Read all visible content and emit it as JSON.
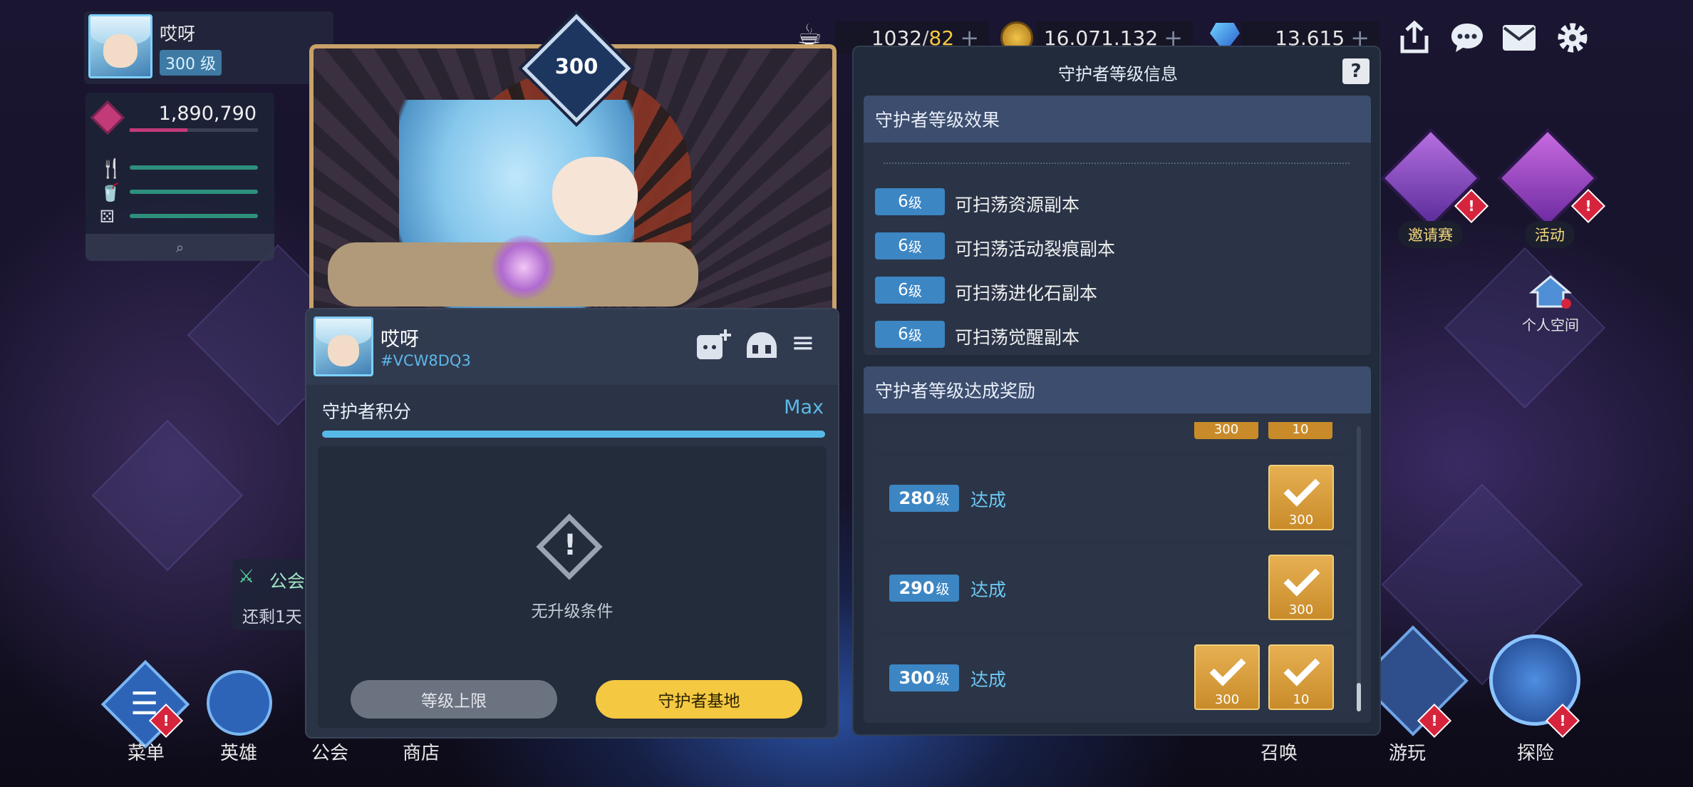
{
  "player": {
    "name": "哎呀",
    "level_label": "300 级",
    "power": "1,890,790"
  },
  "currency": {
    "stamina": "1032",
    "stamina_max": "82",
    "gold": "16.071.132",
    "gems": "13.615"
  },
  "card": {
    "level": "300",
    "name": "哎呀",
    "id": "#VCW8DQ3",
    "score_label": "守护者积分",
    "score_value": "Max",
    "no_upgrade": "无升级条件",
    "btn_limit": "等级上限",
    "btn_base": "守护者基地"
  },
  "info": {
    "title": "守护者等级信息",
    "help": "?",
    "effects_title": "守护者等级效果",
    "effects": [
      {
        "level": "6",
        "unit": "级",
        "text": "可扫荡资源副本"
      },
      {
        "level": "6",
        "unit": "级",
        "text": "可扫荡活动裂痕副本"
      },
      {
        "level": "6",
        "unit": "级",
        "text": "可扫荡进化石副本"
      },
      {
        "level": "6",
        "unit": "级",
        "text": "可扫荡觉醒副本"
      }
    ],
    "rewards_title": "守护者等级达成奖励",
    "partial": {
      "r1": "300",
      "r2": "10"
    },
    "rewards": [
      {
        "level": "280",
        "unit": "级",
        "status": "达成",
        "r1": "300"
      },
      {
        "level": "290",
        "unit": "级",
        "status": "达成",
        "r1": "300"
      },
      {
        "level": "300",
        "unit": "级",
        "status": "达成",
        "r1": "300",
        "r2": "10"
      }
    ]
  },
  "guild_popup": {
    "title": "公会",
    "text": "还剩1天"
  },
  "side": {
    "invite": "邀请赛",
    "event": "活动",
    "personal": "个人空间"
  },
  "nav": {
    "menu": "菜单",
    "hero": "英雄",
    "guild": "公会",
    "shop": "商店",
    "summon": "召唤",
    "play": "游玩",
    "explore": "探险"
  },
  "alert": "!",
  "colors": {
    "accent": "#3c86c4",
    "gold": "#f5c842",
    "done": "#6cc9f5",
    "alert": "#d6243c"
  }
}
